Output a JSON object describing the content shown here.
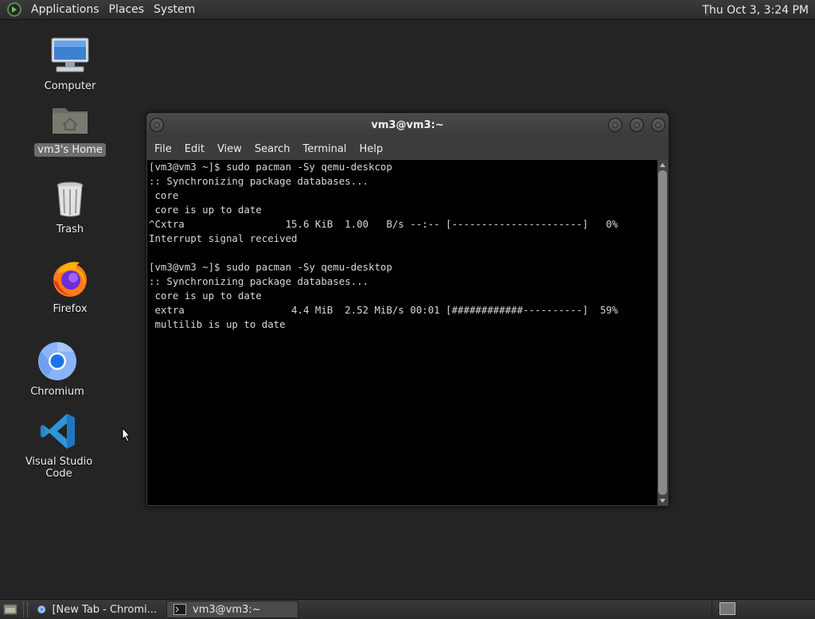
{
  "top_panel": {
    "menus": [
      "Applications",
      "Places",
      "System"
    ],
    "clock": "Thu Oct  3,  3:24 PM"
  },
  "desktop": {
    "icons": [
      {
        "label": "Computer",
        "icon": "computer-icon"
      },
      {
        "label": "vm3's Home",
        "icon": "home-folder-icon"
      },
      {
        "label": "Trash",
        "icon": "trash-icon"
      },
      {
        "label": "Firefox",
        "icon": "firefox-icon"
      },
      {
        "label": "Chromium",
        "icon": "chromium-icon"
      },
      {
        "label": "Visual Studio Code",
        "icon": "vscode-icon"
      }
    ]
  },
  "terminal": {
    "title": "vm3@vm3:~",
    "menus": [
      "File",
      "Edit",
      "View",
      "Search",
      "Terminal",
      "Help"
    ],
    "lines": [
      "[vm3@vm3 ~]$ sudo pacman -Sy qemu-deskcop",
      ":: Synchronizing package databases...",
      " core",
      " core is up to date",
      "^Cxtra                 15.6 KiB  1.00   B/s --:-- [----------------------]   0%",
      "Interrupt signal received",
      "",
      "[vm3@vm3 ~]$ sudo pacman -Sy qemu-desktop",
      ":: Synchronizing package databases...",
      " core is up to date",
      " extra                  4.4 MiB  2.52 MiB/s 00:01 [############----------]  59%",
      " multilib is up to date"
    ]
  },
  "taskbar": {
    "tasks": [
      {
        "label": "[New Tab - Chromi...",
        "active": false
      },
      {
        "label": "vm3@vm3:~",
        "active": true
      }
    ]
  }
}
